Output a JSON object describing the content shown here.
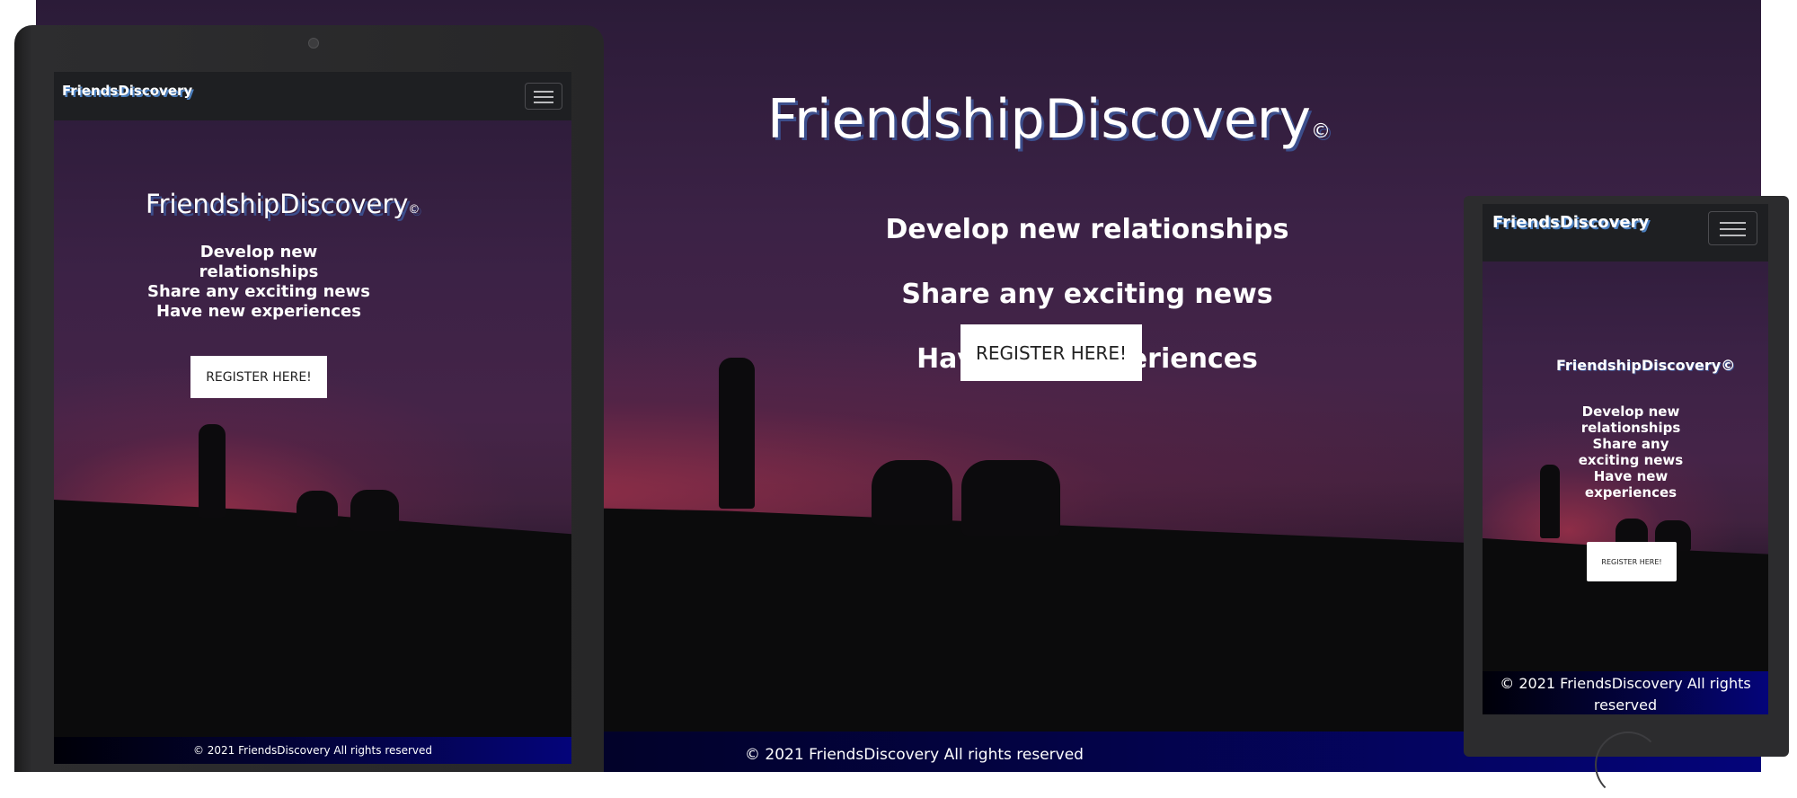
{
  "brand": "FriendsDiscovery",
  "hero": {
    "title": "FriendshipDiscovery",
    "title_mark": "©",
    "mobile_title": "FriendshipDiscovery©",
    "lines": [
      "Develop new relationships",
      "Share any exciting news",
      "Have new experiences"
    ],
    "tablet_lines": "Develop new\nrelationships\nShare any exciting news\nHave new experiences",
    "mobile_lines": "Develop new\nrelationships\nShare any\nexciting news\nHave new\nexperiences",
    "cta": "REGISTER HERE!"
  },
  "footer": {
    "text": "© 2021 FriendsDiscovery All rights reserved",
    "mobile_text": "© 2021 FriendsDiscovery All rights\nreserved"
  },
  "icons": {
    "menu": "hamburger-menu-icon",
    "camera": "front-camera-icon"
  },
  "colors": {
    "sky_top": "#2b1b38",
    "sky_glow": "#aa324b",
    "ground": "#0b0b0c",
    "navbar": "#1e1f22",
    "footer_end": "#04047a",
    "brand_shadow": "#4a7fc0"
  }
}
